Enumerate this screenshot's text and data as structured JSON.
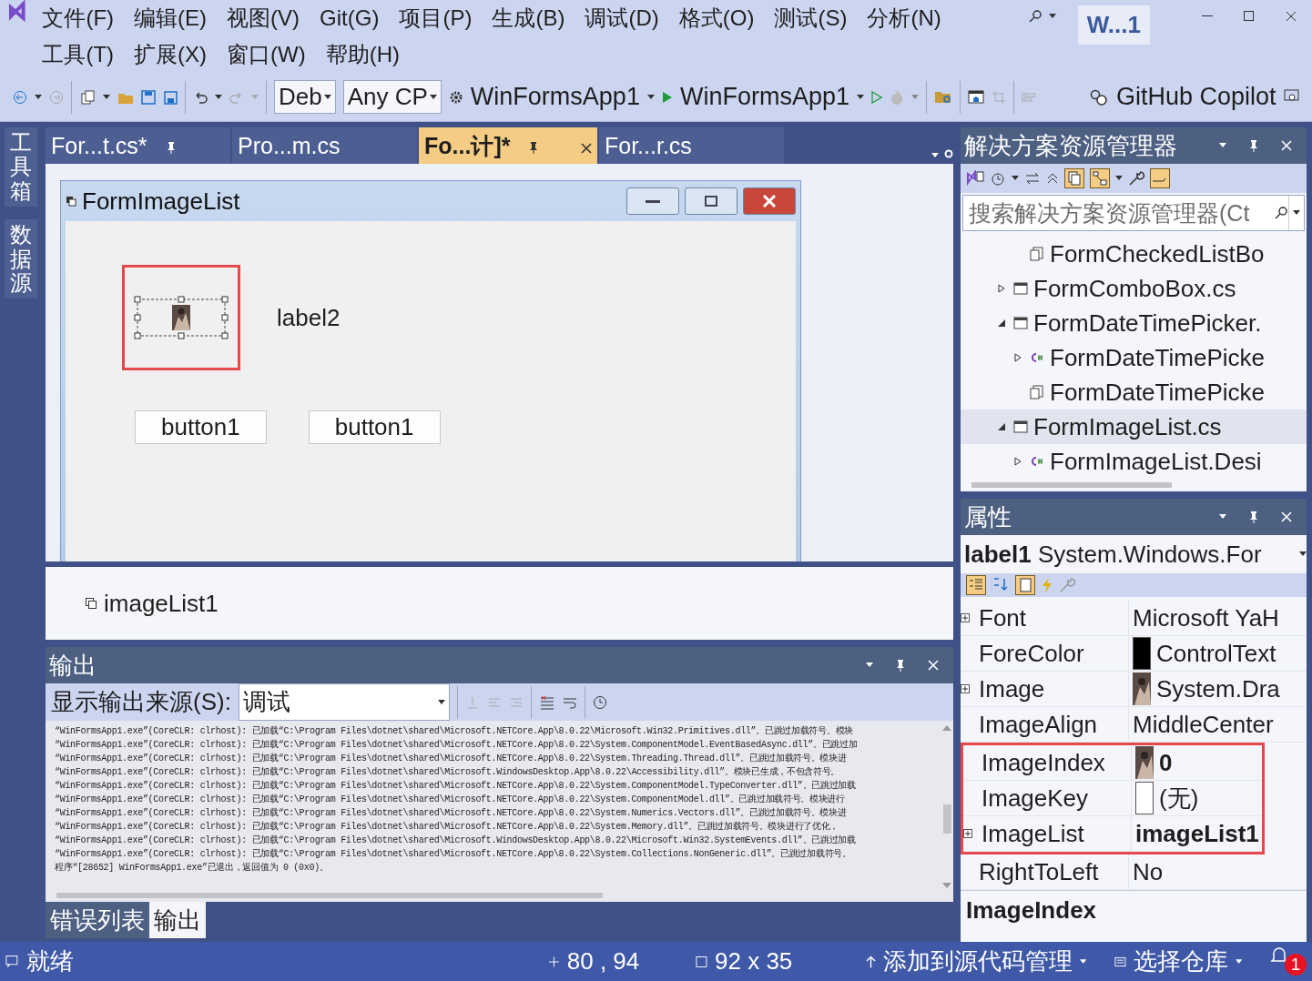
{
  "menu_rows": [
    [
      "文件(F)",
      "编辑(E)",
      "视图(V)",
      "Git(G)",
      "项目(P)",
      "生成(B)",
      "调试(D)",
      "格式(O)",
      "测试(S)",
      "分析(N)"
    ],
    [
      "工具(T)",
      "扩展(X)",
      "窗口(W)",
      "帮助(H)"
    ]
  ],
  "title_badge": "W...1",
  "toolbar": {
    "configuration": "Deb",
    "platform": "Any CP",
    "startup_project": "WinFormsApp1",
    "run_target": "WinFormsApp1",
    "copilot": "GitHub Copilot"
  },
  "side_tabs": [
    "工具箱",
    "数据源"
  ],
  "doc_tabs": [
    {
      "label": "For...t.cs*",
      "selected": false,
      "pinned": true
    },
    {
      "label": "Pro...m.cs",
      "selected": false,
      "pinned": false
    },
    {
      "label": "Fo...计]*",
      "selected": true,
      "pinned": true
    },
    {
      "label": "For...r.cs",
      "selected": false,
      "pinned": false
    }
  ],
  "designer": {
    "form_title": "FormImageList",
    "controls": [
      {
        "kind": "image_label",
        "selected": true,
        "highlighted": true
      },
      {
        "kind": "label",
        "text": "label2"
      },
      {
        "kind": "button",
        "text": "button1"
      },
      {
        "kind": "button",
        "text": "button1"
      }
    ],
    "tray": [
      "imageList1"
    ]
  },
  "output": {
    "title": "输出",
    "source_label": "显示输出来源(S):",
    "source_value": "调试",
    "lines": [
      "“WinFormsApp1.exe”(CoreCLR: clrhost): 已加载“C:\\Program Files\\dotnet\\shared\\Microsoft.NETCore.App\\8.0.22\\Microsoft.Win32.Primitives.dll”。已跳过加载符号。模块",
      "“WinFormsApp1.exe”(CoreCLR: clrhost): 已加载“C:\\Program Files\\dotnet\\shared\\Microsoft.NETCore.App\\8.0.22\\System.ComponentModel.EventBasedAsync.dll”。已跳过加",
      "“WinFormsApp1.exe”(CoreCLR: clrhost): 已加载“C:\\Program Files\\dotnet\\shared\\Microsoft.NETCore.App\\8.0.22\\System.Threading.Thread.dll”。已跳过加载符号。模块进",
      "“WinFormsApp1.exe”(CoreCLR: clrhost): 已加载“C:\\Program Files\\dotnet\\shared\\Microsoft.WindowsDesktop.App\\8.0.22\\Accessibility.dll”。模块已生成，不包含符号。",
      "“WinFormsApp1.exe”(CoreCLR: clrhost): 已加载“C:\\Program Files\\dotnet\\shared\\Microsoft.NETCore.App\\8.0.22\\System.ComponentModel.TypeConverter.dll”。已跳过加载",
      "“WinFormsApp1.exe”(CoreCLR: clrhost): 已加载“C:\\Program Files\\dotnet\\shared\\Microsoft.NETCore.App\\8.0.22\\System.ComponentModel.dll”。已跳过加载符号。模块进行",
      "“WinFormsApp1.exe”(CoreCLR: clrhost): 已加载“C:\\Program Files\\dotnet\\shared\\Microsoft.NETCore.App\\8.0.22\\System.Numerics.Vectors.dll”。已跳过加载符号。模块进",
      "“WinFormsApp1.exe”(CoreCLR: clrhost): 已加载“C:\\Program Files\\dotnet\\shared\\Microsoft.NETCore.App\\8.0.22\\System.Memory.dll”。已跳过加载符号。模块进行了优化，",
      "“WinFormsApp1.exe”(CoreCLR: clrhost): 已加载“C:\\Program Files\\dotnet\\shared\\Microsoft.WindowsDesktop.App\\8.0.22\\Microsoft.Win32.SystemEvents.dll”。已跳过加载",
      "“WinFormsApp1.exe”(CoreCLR: clrhost): 已加载“C:\\Program Files\\dotnet\\shared\\Microsoft.NETCore.App\\8.0.22\\System.Collections.NonGeneric.dll”。已跳过加载符号。",
      "程序“[28652] WinFormsApp1.exe”已退出，返回值为 0 (0x0)。"
    ]
  },
  "bottom_tabs": [
    {
      "label": "错误列表",
      "selected": false
    },
    {
      "label": "输出",
      "selected": true
    }
  ],
  "solution_explorer": {
    "title": "解决方案资源管理器",
    "search_placeholder": "搜索解决方案资源管理器(Ct",
    "continued": [
      {
        "label": "FormCheckedListBo",
        "kind": "resx",
        "selected": false
      }
    ],
    "items": [
      {
        "label": "FormComboBox.cs",
        "kind": "form",
        "expanded": false,
        "selected": false
      },
      {
        "label": "FormDateTimePicker.",
        "kind": "form",
        "expanded": true,
        "selected": false,
        "children": [
          {
            "label": "FormDateTimePicke",
            "kind": "cs",
            "expanded": false,
            "selected": false
          },
          {
            "label": "FormDateTimePicke",
            "kind": "resx",
            "selected": false
          }
        ]
      },
      {
        "label": "FormImageList.cs",
        "kind": "form",
        "expanded": true,
        "selected": true,
        "children": [
          {
            "label": "FormImageList.Desi",
            "kind": "cs",
            "expanded": false,
            "selected": false
          }
        ]
      }
    ]
  },
  "properties": {
    "title": "属性",
    "object": "**label1** System.Windows.For",
    "rows": [
      {
        "name": "Font",
        "value": "Microsoft YaH",
        "kind": "text",
        "expandable": true,
        "modified": false,
        "highlighted": false
      },
      {
        "name": "ForeColor",
        "value": "ControlText",
        "kind": "color",
        "color": "#000000",
        "expandable": false,
        "modified": false,
        "highlighted": false
      },
      {
        "name": "Image",
        "value": "System.Dra",
        "kind": "image",
        "expandable": true,
        "modified": false,
        "highlighted": false
      },
      {
        "name": "ImageAlign",
        "value": "MiddleCenter",
        "kind": "text",
        "expandable": false,
        "modified": false,
        "highlighted": false
      },
      {
        "name": "ImageIndex",
        "value": "0",
        "kind": "image",
        "expandable": false,
        "modified": true,
        "highlighted": true
      },
      {
        "name": "ImageKey",
        "value": "(无)",
        "kind": "empty",
        "expandable": false,
        "modified": false,
        "highlighted": true
      },
      {
        "name": "ImageList",
        "value": "imageList1",
        "kind": "text",
        "expandable": true,
        "modified": true,
        "highlighted": true
      },
      {
        "name": "RightToLeft",
        "value": "No",
        "kind": "text",
        "expandable": false,
        "modified": false,
        "highlighted": false
      }
    ],
    "description_title": "ImageIndex"
  },
  "status": {
    "ready": "就绪",
    "position": "80 , 94",
    "size": "92 x 35",
    "source_control": "添加到源代码管理",
    "repository": "选择仓库",
    "notifications": "1"
  }
}
